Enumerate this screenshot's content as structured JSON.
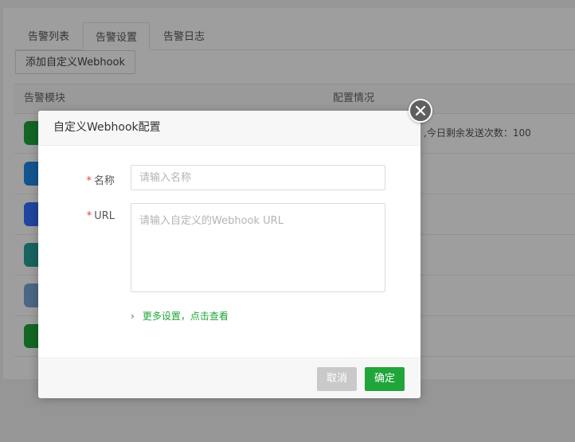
{
  "tabs": [
    {
      "label": "告警列表"
    },
    {
      "label": "告警设置"
    },
    {
      "label": "告警日志"
    }
  ],
  "add_button_label": "添加自定义Webhook",
  "table": {
    "headers": [
      "告警模块",
      "配置情况"
    ],
    "rows": [
      {
        "icon": "wechat-icon",
        "color": "#20a53a",
        "config": "】,今日剩余发送次数：100"
      },
      {
        "icon": "mail-icon",
        "color": "#1e88e5",
        "config": ""
      },
      {
        "icon": "feishu-icon",
        "color": "#3370ff",
        "config": ""
      },
      {
        "icon": "telegram-icon",
        "color": "#2aa198",
        "config": ""
      },
      {
        "icon": "chat-bubble-icon",
        "color": "#7aa7d6",
        "config": ""
      },
      {
        "icon": "wechat-work-icon",
        "color": "#20a53a",
        "config": ""
      }
    ]
  },
  "dialog": {
    "title": "自定义Webhook配置",
    "name_label": "名称",
    "name_placeholder": "请输入名称",
    "name_value": "",
    "url_label": "URL",
    "url_placeholder": "请输入自定义的Webhook URL",
    "url_value": "",
    "required_mark": "*",
    "more_settings": "更多设置，点击查看",
    "cancel_label": "取消",
    "confirm_label": "确定"
  },
  "colors": {
    "accent": "#20a53a",
    "required": "#e0433a",
    "cancel": "#c9c9c9"
  }
}
